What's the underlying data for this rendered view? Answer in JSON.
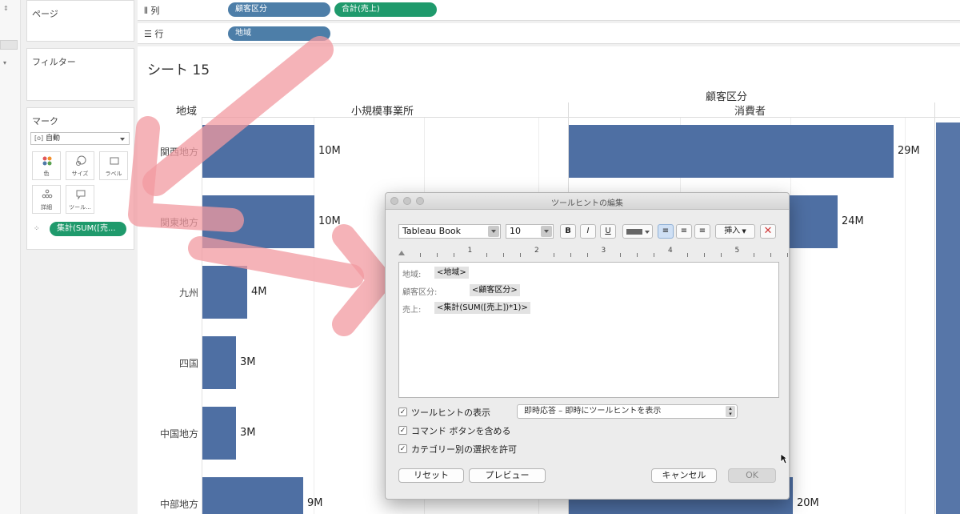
{
  "sidepanels": {
    "pages_title": "ページ",
    "filters_title": "フィルター",
    "marks": {
      "title": "マーク",
      "mark_type": "自動",
      "buttons": [
        {
          "label": "色",
          "icon": "color-icon"
        },
        {
          "label": "サイズ",
          "icon": "size-icon"
        },
        {
          "label": "ラベル",
          "icon": "label-icon"
        },
        {
          "label": "詳細",
          "icon": "detail-icon"
        },
        {
          "label": "ツール...",
          "icon": "tooltip-icon"
        }
      ],
      "measure_pill": "集計(SUM([売..."
    }
  },
  "shelves": {
    "columns_label": "列",
    "rows_label": "行",
    "column_pills": [
      "顧客区分",
      "合計(売上)"
    ],
    "row_pills": [
      "地域"
    ]
  },
  "sheet": {
    "title": "シート 15",
    "row_header": "地域",
    "column_group_header": "顧客区分"
  },
  "chart_data": {
    "type": "bar",
    "categories": [
      "関西地方",
      "関東地方",
      "九州",
      "四国",
      "中国地方",
      "中部地方"
    ],
    "series": [
      {
        "name": "小規模事業所",
        "values": [
          10,
          10,
          4,
          3,
          3,
          9
        ],
        "labels": [
          "10M",
          "10M",
          "4M",
          "3M",
          "3M",
          "9M"
        ]
      },
      {
        "name": "消費者",
        "values": [
          29,
          24,
          null,
          null,
          null,
          20
        ],
        "labels": [
          "29M",
          "24M",
          "",
          "",
          "",
          "20M"
        ]
      }
    ],
    "xlim": [
      0,
      30
    ]
  },
  "dialog": {
    "title": "ツールヒントの編集",
    "font_name": "Tableau Book",
    "font_size": "10",
    "bold": "B",
    "italic": "I",
    "underline": "U",
    "insert_label": "挿入",
    "ruler_numbers": [
      "1",
      "2",
      "3",
      "4",
      "5"
    ],
    "lines": [
      {
        "label": "地域:",
        "field": "<地域>"
      },
      {
        "label": "顧客区分:",
        "field": "<顧客区分>"
      },
      {
        "label": "売上:",
        "field": "<集計(SUM([売上])*1)>"
      }
    ],
    "show_tooltip_label": "ツールヒントの表示",
    "tooltip_mode": "即時応答 – 即時にツールヒントを表示",
    "include_command_buttons_label": "コマンド ボタンを含める",
    "allow_category_selection_label": "カテゴリー別の選択を許可",
    "reset_label": "リセット",
    "preview_label": "プレビュー",
    "cancel_label": "キャンセル",
    "ok_label": "OK",
    "checks": [
      true,
      true,
      true
    ]
  },
  "colors": {
    "bar": "#4e6fa3",
    "pill_blue": "#4d7ea8",
    "pill_green": "#1f9a6c",
    "arrow": "#f19aa0"
  }
}
